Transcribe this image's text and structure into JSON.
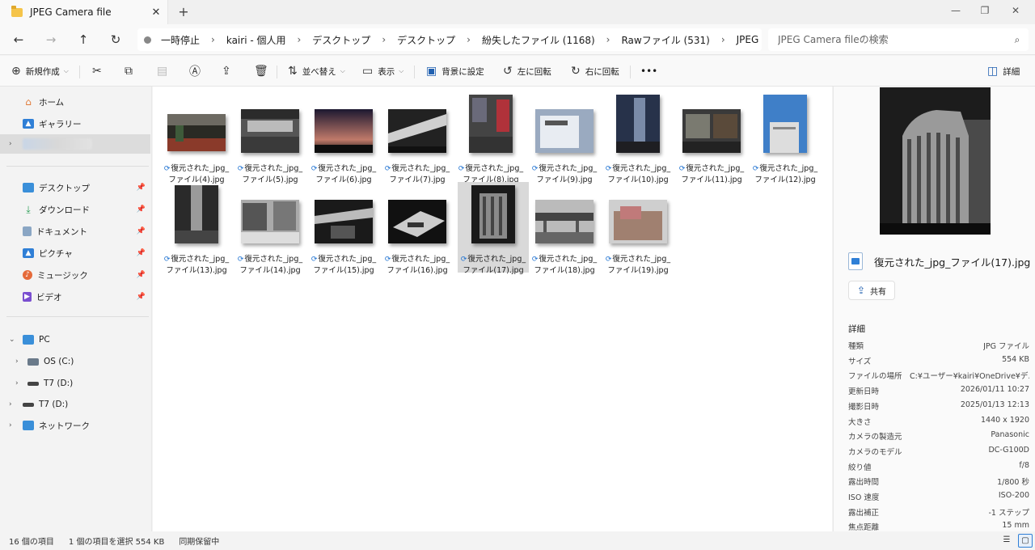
{
  "window": {
    "tab_title": "JPEG Camera file",
    "close_tab": "✕",
    "new_tab": "+",
    "minimize": "—",
    "restore": "❐",
    "close": "✕"
  },
  "nav": {
    "back": "←",
    "forward": "→",
    "up": "↑",
    "refresh": "↻"
  },
  "breadcrumb": [
    "一時停止",
    "kairi - 個人用",
    "デスクトップ",
    "デスクトップ",
    "紛失したファイル (1168)",
    "Rawファイル (531)",
    "JPEG Camera file"
  ],
  "search": {
    "placeholder": "JPEG Camera fileの検索"
  },
  "toolbar": {
    "new": "新規作成",
    "sort": "並べ替え",
    "view": "表示",
    "set_background": "背景に設定",
    "rotate_left": "左に回転",
    "rotate_right": "右に回転",
    "more": "•••",
    "details": "詳細"
  },
  "sidebar": {
    "home": "ホーム",
    "gallery": "ギャラリー",
    "desktop": "デスクトップ",
    "downloads": "ダウンロード",
    "documents": "ドキュメント",
    "pictures": "ピクチャ",
    "music": "ミュージック",
    "videos": "ビデオ",
    "pc": "PC",
    "os_c": "OS (C:)",
    "t7_d_1": "T7 (D:)",
    "t7_d_2": "T7 (D:)",
    "network": "ネットワーク"
  },
  "files": [
    {
      "line1": "復元された_jpg_",
      "line2": "ファイル(4).jpg"
    },
    {
      "line1": "復元された_jpg_",
      "line2": "ファイル(5).jpg"
    },
    {
      "line1": "復元された_jpg_",
      "line2": "ファイル(6).jpg"
    },
    {
      "line1": "復元された_jpg_",
      "line2": "ファイル(7).jpg"
    },
    {
      "line1": "復元された_jpg_",
      "line2": "ファイル(8).jpg"
    },
    {
      "line1": "復元された_jpg_",
      "line2": "ファイル(9).jpg"
    },
    {
      "line1": "復元された_jpg_",
      "line2": "ファイル(10).jpg"
    },
    {
      "line1": "復元された_jpg_",
      "line2": "ファイル(11).jpg"
    },
    {
      "line1": "復元された_jpg_",
      "line2": "ファイル(12).jpg"
    },
    {
      "line1": "復元された_jpg_",
      "line2": "ファイル(13).jpg"
    },
    {
      "line1": "復元された_jpg_",
      "line2": "ファイル(14).jpg"
    },
    {
      "line1": "復元された_jpg_",
      "line2": "ファイル(15).jpg"
    },
    {
      "line1": "復元された_jpg_",
      "line2": "ファイル(16).jpg"
    },
    {
      "line1": "復元された_jpg_",
      "line2": "ファイル(17).jpg"
    },
    {
      "line1": "復元された_jpg_",
      "line2": "ファイル(18).jpg"
    },
    {
      "line1": "復元された_jpg_",
      "line2": "ファイル(19).jpg"
    }
  ],
  "details": {
    "file_name": "復元された_jpg_ファイル(17).jpg",
    "share": "共有",
    "section_title": "詳細",
    "rows": [
      {
        "k": "種類",
        "v": "JPG ファイル"
      },
      {
        "k": "サイズ",
        "v": "554 KB"
      },
      {
        "k": "ファイルの場所",
        "v": "C:¥ユーザー¥kairi¥OneDrive¥デ..."
      },
      {
        "k": "更新日時",
        "v": "2026/01/11 10:27"
      },
      {
        "k": "撮影日時",
        "v": "2025/01/13 12:13"
      },
      {
        "k": "大きさ",
        "v": "1440 x 1920"
      },
      {
        "k": "カメラの製造元",
        "v": "Panasonic"
      },
      {
        "k": "カメラのモデル",
        "v": "DC-G100D"
      },
      {
        "k": "絞り値",
        "v": "f/8"
      },
      {
        "k": "露出時間",
        "v": "1/800 秒"
      },
      {
        "k": "ISO 速度",
        "v": "ISO-200"
      },
      {
        "k": "露出補正",
        "v": "-1 ステップ"
      },
      {
        "k": "焦点距離",
        "v": "15 mm"
      }
    ]
  },
  "status": {
    "count": "16 個の項目",
    "selected": "1 個の項目を選択  554 KB",
    "sync": "同期保留中"
  }
}
